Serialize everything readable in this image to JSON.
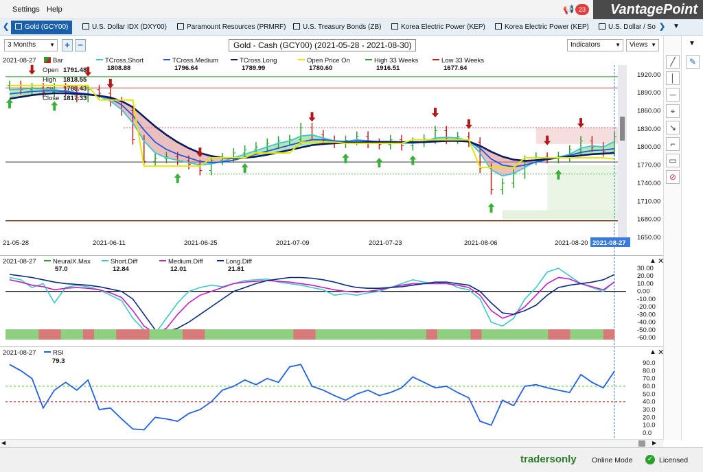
{
  "menu": [
    "Settings",
    "Help"
  ],
  "brand": "VantagePoint",
  "notifications": "23",
  "tabs": [
    {
      "label": "Gold (GCY00)",
      "active": true
    },
    {
      "label": "U.S. Dollar IDX (DXY00)"
    },
    {
      "label": "Paramount Resources (PRMRF)"
    },
    {
      "label": "U.S. Treasury Bonds (ZB)"
    },
    {
      "label": "Korea Electric Power (KEP)"
    },
    {
      "label": "Korea Electric Power (KEP)"
    },
    {
      "label": "U.S. Dollar / So"
    }
  ],
  "toolbar": {
    "period": "3 Months",
    "add": "+",
    "remove": "−",
    "title": "Gold - Cash (GCY00) (2021-05-28 - 2021-08-30)",
    "indicators": "Indicators",
    "views": "Views"
  },
  "price_legend": {
    "date": "2021-08-27",
    "bar_label": "Bar",
    "open_label": "Open",
    "open": "1791.48",
    "high_label": "High",
    "high": "1818.55",
    "low_label": "Low",
    "low": "1788.43",
    "close_label": "Close",
    "close": "1817.33",
    "items": [
      {
        "name": "TCross.Short",
        "value": "1808.88",
        "color": "#3cc8c8"
      },
      {
        "name": "TCross.Medium",
        "value": "1796.64",
        "color": "#2255dd"
      },
      {
        "name": "TCross.Long",
        "value": "1789.99",
        "color": "#0a1a5c"
      },
      {
        "name": "Open Price On",
        "value": "1780.60",
        "color": "#e6e600"
      },
      {
        "name": "High 33 Weeks",
        "value": "1916.51",
        "color": "#2aa02a"
      },
      {
        "name": "Low 33 Weeks",
        "value": "1677.64",
        "color": "#c02020"
      }
    ]
  },
  "price_axis": [
    "1920.00",
    "1890.00",
    "1860.00",
    "1830.00",
    "1800.00",
    "1770.00",
    "1740.00",
    "1710.00",
    "1680.00",
    "1650.00"
  ],
  "date_axis": [
    "21-05-28",
    "2021-06-11",
    "2021-06-25",
    "2021-07-09",
    "2021-07-23",
    "2021-08-06",
    "2021-08-20",
    "2021-08-27"
  ],
  "neural_legend": {
    "date": "2021-08-27",
    "items": [
      {
        "name": "NeuralX.Max",
        "value": "57.0",
        "color": "#2aa02a"
      },
      {
        "name": "Short.Diff",
        "value": "12.84",
        "color": "#3cc8c8"
      },
      {
        "name": "Medium.Diff",
        "value": "12.01",
        "color": "#c020c0"
      },
      {
        "name": "Long.Diff",
        "value": "21.81",
        "color": "#0a2a7c"
      }
    ]
  },
  "neural_axis": [
    "30.00",
    "20.00",
    "10.00",
    "0.00",
    "-10.00",
    "-20.00",
    "-30.00",
    "-40.00",
    "-50.00",
    "-60.00"
  ],
  "rsi_legend": {
    "date": "2021-08-27",
    "name": "RSI",
    "value": "79.3",
    "color": "#2060e0"
  },
  "rsi_axis": [
    "90.0",
    "80.0",
    "70.0",
    "60.0",
    "50.0",
    "40.0",
    "30.0",
    "20.0",
    "10.0",
    "0.0"
  ],
  "status": {
    "traders": "tradersonly",
    "mode": "Online Mode",
    "license": "Licensed"
  },
  "chart_data": [
    {
      "type": "line",
      "title": "Gold - Cash (GCY00) (2021-05-28 - 2021-08-30)",
      "ylim": [
        1650,
        1930
      ],
      "levels": {
        "high_33_weeks": 1916.51,
        "low_33_weeks": 1677.64,
        "open_price_on": 1780.6
      },
      "series": [
        {
          "name": "Close",
          "values": [
            1902,
            1895,
            1898,
            1891,
            1898,
            1893,
            1882,
            1895,
            1889,
            1875,
            1860,
            1812,
            1776,
            1781,
            1784,
            1778,
            1771,
            1761,
            1778,
            1782,
            1790,
            1795,
            1800,
            1806,
            1810,
            1812,
            1832,
            1820,
            1811,
            1806,
            1811,
            1818,
            1806,
            1804,
            1812,
            1802,
            1808,
            1813,
            1827,
            1813,
            1817,
            1808,
            1765,
            1729,
            1740,
            1755,
            1778,
            1783,
            1781,
            1784,
            1795,
            1810,
            1800,
            1792,
            1817
          ]
        },
        {
          "name": "TCross.Short",
          "values": [
            1895,
            1896,
            1897,
            1896,
            1895,
            1893,
            1890,
            1888,
            1884,
            1876,
            1862,
            1840,
            1810,
            1790,
            1782,
            1778,
            1774,
            1770,
            1772,
            1776,
            1782,
            1788,
            1794,
            1800,
            1806,
            1810,
            1818,
            1820,
            1815,
            1810,
            1809,
            1812,
            1810,
            1807,
            1808,
            1806,
            1806,
            1808,
            1815,
            1816,
            1815,
            1810,
            1790,
            1762,
            1752,
            1756,
            1766,
            1776,
            1780,
            1783,
            1788,
            1798,
            1802,
            1800,
            1809
          ]
        },
        {
          "name": "TCross.Medium",
          "values": [
            1888,
            1890,
            1892,
            1893,
            1893,
            1892,
            1890,
            1888,
            1885,
            1880,
            1870,
            1852,
            1828,
            1808,
            1796,
            1788,
            1782,
            1776,
            1774,
            1775,
            1778,
            1783,
            1788,
            1793,
            1798,
            1803,
            1808,
            1812,
            1812,
            1810,
            1809,
            1810,
            1810,
            1809,
            1809,
            1808,
            1807,
            1808,
            1811,
            1812,
            1812,
            1810,
            1798,
            1780,
            1770,
            1767,
            1770,
            1775,
            1779,
            1782,
            1786,
            1791,
            1794,
            1795,
            1797
          ]
        },
        {
          "name": "TCross.Long",
          "values": [
            1880,
            1883,
            1886,
            1888,
            1889,
            1889,
            1888,
            1887,
            1885,
            1882,
            1876,
            1866,
            1850,
            1834,
            1820,
            1808,
            1798,
            1790,
            1785,
            1782,
            1781,
            1782,
            1784,
            1787,
            1791,
            1795,
            1799,
            1803,
            1805,
            1806,
            1807,
            1807,
            1808,
            1808,
            1808,
            1808,
            1808,
            1808,
            1809,
            1810,
            1810,
            1809,
            1802,
            1792,
            1784,
            1779,
            1777,
            1778,
            1780,
            1782,
            1784,
            1786,
            1788,
            1789,
            1790
          ]
        },
        {
          "name": "Open Price On",
          "values": [
            1902,
            1902,
            1902,
            1902,
            1902,
            1902,
            1902,
            1902,
            1878,
            1878,
            1878,
            1878,
            1768,
            1768,
            1768,
            1768,
            1768,
            1768,
            1782,
            1782,
            1782,
            1782,
            1790,
            1790,
            1790,
            1790,
            1808,
            1808,
            1808,
            1808,
            1806,
            1806,
            1806,
            1806,
            1806,
            1806,
            1812,
            1812,
            1812,
            1812,
            1812,
            1812,
            1766,
            1766,
            1766,
            1766,
            1782,
            1782,
            1782,
            1782,
            1782,
            1782,
            1782,
            1782,
            1780
          ]
        }
      ]
    },
    {
      "type": "line",
      "ylim": [
        -60,
        30
      ],
      "series": [
        {
          "name": "Short.Diff",
          "values": [
            18,
            15,
            5,
            10,
            -15,
            5,
            8,
            6,
            2,
            -5,
            -12,
            -35,
            -50,
            -55,
            -35,
            -15,
            0,
            5,
            8,
            6,
            10,
            14,
            15,
            16,
            12,
            10,
            8,
            5,
            2,
            -5,
            -3,
            -5,
            -2,
            0,
            5,
            10,
            15,
            12,
            10,
            12,
            5,
            2,
            -10,
            -40,
            -45,
            -35,
            -10,
            5,
            25,
            30,
            20,
            10,
            5,
            0,
            12.84
          ]
        },
        {
          "name": "Medium.Diff",
          "values": [
            15,
            12,
            8,
            6,
            2,
            4,
            5,
            4,
            2,
            -2,
            -8,
            -25,
            -45,
            -55,
            -48,
            -30,
            -15,
            -5,
            0,
            5,
            10,
            12,
            13,
            14,
            13,
            12,
            10,
            8,
            5,
            2,
            0,
            -1,
            0,
            2,
            5,
            8,
            10,
            10,
            10,
            10,
            8,
            5,
            -5,
            -25,
            -35,
            -30,
            -20,
            -5,
            10,
            18,
            16,
            10,
            6,
            2,
            12.01
          ]
        },
        {
          "name": "Long.Diff",
          "values": [
            22,
            20,
            18,
            15,
            12,
            10,
            9,
            8,
            6,
            3,
            0,
            -10,
            -30,
            -50,
            -52,
            -48,
            -40,
            -30,
            -20,
            -10,
            0,
            5,
            10,
            14,
            16,
            18,
            18,
            17,
            15,
            12,
            8,
            5,
            4,
            4,
            5,
            6,
            8,
            10,
            12,
            12,
            10,
            8,
            0,
            -15,
            -28,
            -30,
            -25,
            -18,
            -5,
            5,
            8,
            10,
            12,
            15,
            21.81
          ]
        },
        {
          "name": "NeuralX.Max",
          "values": [
            57
          ]
        }
      ]
    },
    {
      "type": "line",
      "ylim": [
        0,
        90
      ],
      "levels": {
        "upper": 60,
        "lower": 40
      },
      "series": [
        {
          "name": "RSI",
          "values": [
            88,
            80,
            70,
            32,
            55,
            65,
            55,
            68,
            30,
            32,
            18,
            5,
            4,
            20,
            18,
            15,
            25,
            30,
            40,
            55,
            60,
            68,
            62,
            70,
            65,
            85,
            88,
            60,
            55,
            48,
            42,
            50,
            55,
            48,
            52,
            58,
            72,
            65,
            58,
            60,
            52,
            45,
            15,
            10,
            42,
            35,
            60,
            62,
            58,
            55,
            52,
            75,
            65,
            58,
            79.3
          ]
        }
      ]
    }
  ]
}
